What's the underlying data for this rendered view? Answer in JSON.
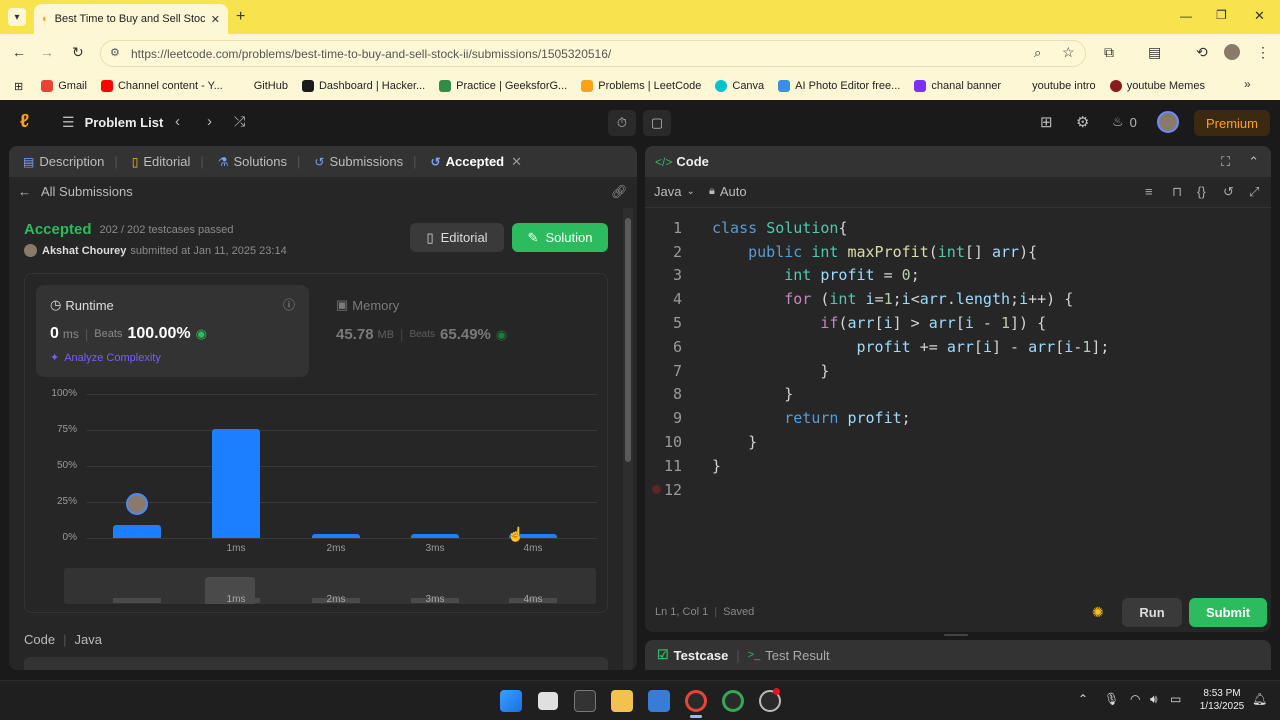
{
  "browser": {
    "tab_title": "Best Time to Buy and Sell Stock",
    "url": "https://leetcode.com/problems/best-time-to-buy-and-sell-stock-ii/submissions/1505320516/",
    "bookmarks": [
      "Gmail",
      "Channel content - Y...",
      "GitHub",
      "Dashboard | Hacker...",
      "Practice | GeeksforG...",
      "Problems | LeetCode",
      "Canva",
      "AI Photo Editor free...",
      "chanal banner",
      "youtube intro",
      "youtube Memes"
    ]
  },
  "nav": {
    "problem_list": "Problem List",
    "streak_count": "0",
    "premium": "Premium"
  },
  "left_tabs": [
    "Description",
    "Editorial",
    "Solutions",
    "Submissions",
    "Accepted"
  ],
  "submission": {
    "back_label": "All Submissions",
    "status": "Accepted",
    "testcases": "202 / 202 testcases passed",
    "user": "Akshat Chourey",
    "submitted_at": "submitted at Jan 11, 2025 23:14",
    "editorial_btn": "Editorial",
    "solution_btn": "Solution",
    "runtime": {
      "label": "Runtime",
      "value": "0",
      "unit": "ms",
      "beats_label": "Beats",
      "beats": "100.00%",
      "analyze": "Analyze Complexity"
    },
    "memory": {
      "label": "Memory",
      "value": "45.78",
      "unit": "MB",
      "beats_label": "Beats",
      "beats": "65.49%"
    },
    "code_label": "Code",
    "code_lang": "Java"
  },
  "chart_data": {
    "type": "bar",
    "y_ticks": [
      "100%",
      "75%",
      "50%",
      "25%",
      "0%"
    ],
    "ylim": [
      0,
      100
    ],
    "x_labels": [
      "",
      "1ms",
      "2ms",
      "3ms",
      "4ms"
    ],
    "values": [
      9,
      76,
      3,
      3,
      3
    ],
    "highlight_index": 0,
    "bar_color": "#1b7fff",
    "mini_labels": [
      "",
      "1ms",
      "2ms",
      "3ms",
      "4ms"
    ]
  },
  "editor": {
    "title": "Code",
    "language": "Java",
    "mode": "Auto",
    "status_pos": "Ln 1, Col 1",
    "status_saved": "Saved",
    "run": "Run",
    "submit": "Submit",
    "lines": [
      "class Solution{",
      "    public int maxProfit(int[] arr){",
      "        int profit = 0;",
      "        for (int i=1;i<arr.length;i++) {",
      "            if(arr[i] > arr[i - 1]) {",
      "                profit += arr[i] - arr[i-1];",
      "            }",
      "        }",
      "        return profit;",
      "    }",
      "}",
      ""
    ]
  },
  "bottom": {
    "testcase": "Testcase",
    "test_result": "Test Result"
  },
  "taskbar": {
    "time": "8:53 PM",
    "date": "1/13/2025"
  },
  "colors": {
    "accent": "#ffa116",
    "green": "#2cbb5d",
    "blue": "#1b7fff"
  }
}
